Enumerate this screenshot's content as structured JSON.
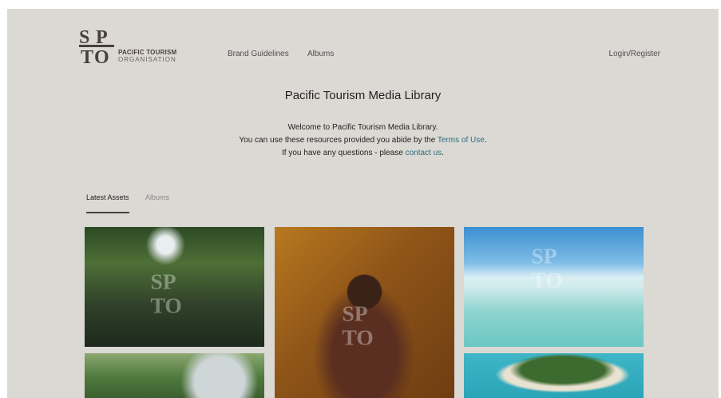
{
  "header": {
    "logo_line1": "PACIFIC TOURISM",
    "logo_line2": "ORGANISATION",
    "nav": [
      "Brand Guidelines",
      "Albums"
    ],
    "login": "Login/Register"
  },
  "intro": {
    "title": "Pacific Tourism Media Library",
    "line1": "Welcome to Pacific Tourism Media Library.",
    "line2_pre": "You can use these resources provided you abide by the ",
    "line2_link": "Terms of Use",
    "line2_post": ".",
    "line3_pre": "If you have any questions - please ",
    "line3_link": "contact us",
    "line3_post": "."
  },
  "tabs": [
    "Latest Assets",
    "Albums"
  ],
  "gallery": {
    "tiles": [
      {
        "name": "waterfall"
      },
      {
        "name": "dancer"
      },
      {
        "name": "beach"
      },
      {
        "name": "forest"
      },
      {
        "name": "island"
      }
    ]
  },
  "colors": {
    "background": "#dbd9d4",
    "link": "#2e6c7d",
    "logo": "#4a403a"
  }
}
